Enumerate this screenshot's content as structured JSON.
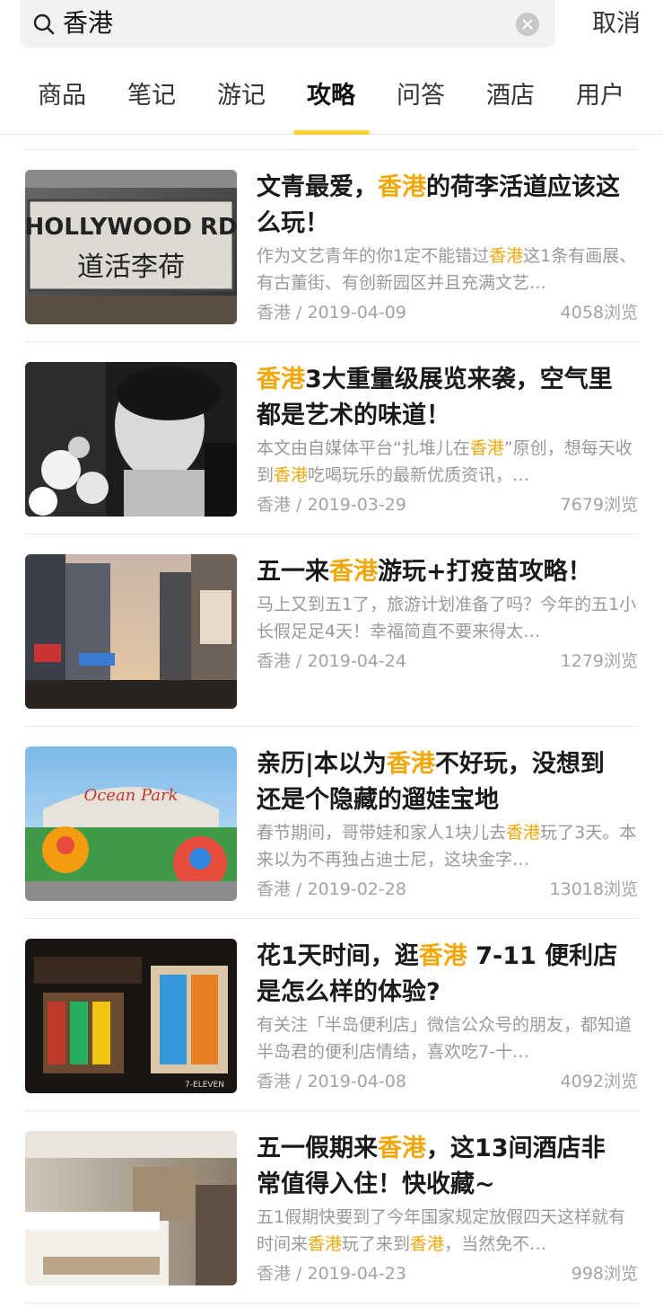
{
  "search": {
    "query": "香港"
  },
  "cancel_label": "取消",
  "tabs": [
    "商品",
    "笔记",
    "游记",
    "攻略",
    "问答",
    "酒店",
    "用户"
  ],
  "active_tab": "攻略",
  "highlight_color": "#f0a70a",
  "accent_color": "#ffd12e",
  "articles": [
    {
      "title_parts": [
        "文青最爱，",
        "香港",
        "的荷李活道应该这么玩！"
      ],
      "desc_parts": [
        "作为文艺青年的你1定不能错过",
        "香港",
        "这1条有画展、有古董街、有创新园区并且充满文艺…"
      ],
      "location": "香港",
      "date": "2019-04-09",
      "views": "4058浏览"
    },
    {
      "title_parts": [
        "",
        "香港",
        "3大重量级展览来袭，空气里都是艺术的味道！"
      ],
      "desc_parts": [
        "本文由自媒体平台“扎堆儿在",
        "香港",
        "”原创，想每天收到",
        "香港",
        "吃喝玩乐的最新优质资讯，…"
      ],
      "location": "香港",
      "date": "2019-03-29",
      "views": "7679浏览"
    },
    {
      "title_parts": [
        "五一来",
        "香港",
        "游玩+打疫苗攻略！"
      ],
      "desc_parts": [
        "马上又到五1了，旅游计划准备了吗？今年的五1小长假足足4天！幸福简直不要来得太…"
      ],
      "location": "香港",
      "date": "2019-04-24",
      "views": "1279浏览"
    },
    {
      "title_parts": [
        "亲历|本以为",
        "香港",
        "不好玩，没想到还是个隐藏的遛娃宝地"
      ],
      "desc_parts": [
        "春节期间，哥带娃和家人1块儿去",
        "香港",
        "玩了3天。本来以为不再独占迪士尼，这块金字…"
      ],
      "location": "香港",
      "date": "2019-02-28",
      "views": "13018浏览"
    },
    {
      "title_parts": [
        "花1天时间，逛",
        "香港",
        " 7-11 便利店是怎么样的体验?"
      ],
      "desc_parts": [
        "有关注「半岛便利店」微信公众号的朋友，都知道半岛君的便利店情结，喜欢吃7-十…"
      ],
      "location": "香港",
      "date": "2019-04-08",
      "views": "4092浏览"
    },
    {
      "title_parts": [
        "五一假期来",
        "香港",
        "，这13间酒店非常值得入住！快收藏~"
      ],
      "desc_parts": [
        "五1假期快要到了今年国家规定放假四天这样就有时间来",
        "香港",
        "玩了来到",
        "香港",
        "，当然免不…"
      ],
      "location": "香港",
      "date": "2019-04-23",
      "views": "998浏览"
    }
  ],
  "sign_texts": [
    "HOLLYWOOD RD",
    "道活李荷"
  ],
  "mall_sign": "Ocean Park",
  "store_sign": "7-ELEVEN"
}
